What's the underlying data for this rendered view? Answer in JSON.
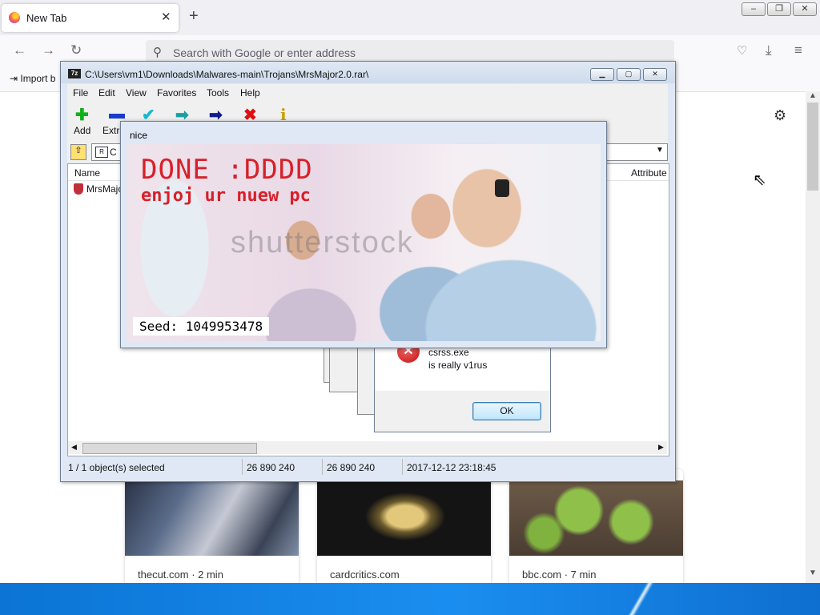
{
  "browser": {
    "tab_title": "New Tab",
    "tab_close": "✕",
    "new_tab": "+",
    "url_placeholder": "Search with Google or enter address",
    "import_bookmarks": "Import b",
    "window_controls": [
      "–",
      "❐",
      "✕"
    ]
  },
  "sevenzip": {
    "title": "C:\\Users\\vm1\\Downloads\\Malwares-main\\Trojans\\MrsMajor2.0.rar\\",
    "app_icon_text": "7z",
    "menu": [
      "File",
      "Edit",
      "View",
      "Favorites",
      "Tools",
      "Help"
    ],
    "toolbar": [
      {
        "label": "Add",
        "icon": "plus-icon",
        "glyph": "✚",
        "color": "#12b01a"
      },
      {
        "label": "Extra",
        "icon": "minus-icon",
        "glyph": "▬",
        "color": "#1b3cc8"
      },
      {
        "label": "",
        "icon": "check-icon",
        "glyph": "✔",
        "color": "#1ab8d0"
      },
      {
        "label": "",
        "icon": "copy-arrow-icon",
        "glyph": "➡",
        "color": "#1aa0a0"
      },
      {
        "label": "",
        "icon": "move-arrow-icon",
        "glyph": "➡",
        "color": "#101c8c"
      },
      {
        "label": "",
        "icon": "delete-icon",
        "glyph": "✖",
        "color": "#e01010"
      },
      {
        "label": "",
        "icon": "info-icon",
        "glyph": "i",
        "color": "#c8a000"
      }
    ],
    "address_path": "C",
    "columns": {
      "name": "Name",
      "attributes": "Attribute"
    },
    "row": {
      "name": "MrsMajo"
    },
    "status": {
      "selected": "1 / 1 object(s) selected",
      "size": "26 890 240",
      "packed": "26 890 240",
      "modified": "2017-12-12 23:18:45"
    }
  },
  "error_dialog": {
    "line1": "csrss.exe",
    "line2": "is really v1rus",
    "ok": "OK"
  },
  "nice_dialog": {
    "title": "nice",
    "headline": "DONE :DDDD",
    "subline": "enjoj ur nuew pc",
    "watermark": "shutterstock",
    "seed": "Seed: 1049953478"
  },
  "topsites": [
    {
      "label": "thecut.com · 2 min"
    },
    {
      "label": "cardcritics.com"
    },
    {
      "label": "bbc.com · 7 min"
    }
  ]
}
